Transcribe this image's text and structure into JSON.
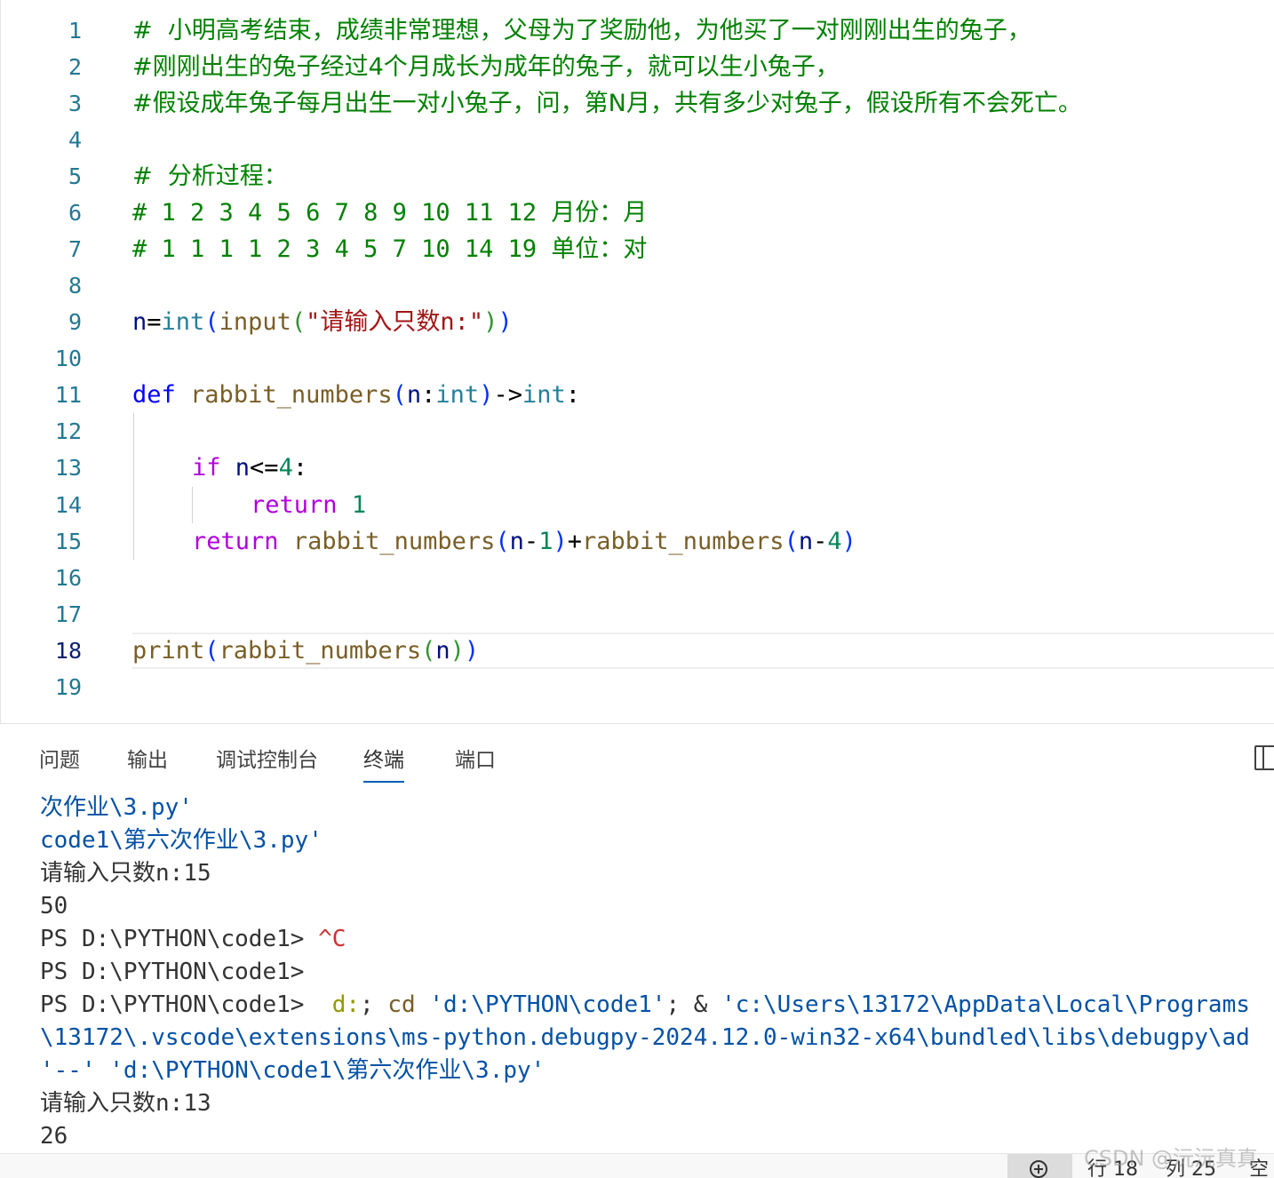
{
  "editor": {
    "active_line": "18",
    "lines": [
      {
        "num": "1",
        "comment": "#  小明高考结束，成绩非常理想，父母为了奖励他，为他买了一对刚刚出生的兔子，"
      },
      {
        "num": "2",
        "comment": "#刚刚出生的兔子经过4个月成长为成年的兔子，就可以生小兔子，"
      },
      {
        "num": "3",
        "comment": "#假设成年兔子每月出生一对小兔子，问，第N月，共有多少对兔子，假设所有不会死亡。"
      },
      {
        "num": "4"
      },
      {
        "num": "5",
        "comment": "#  分析过程："
      },
      {
        "num": "6",
        "comment": "# 1 2 3 4 5 6 7 8 9 10 11 12 月份：月"
      },
      {
        "num": "7",
        "comment": "# 1 1 1 1 2 3 4 5 7 10 14 19 单位：对"
      },
      {
        "num": "8"
      },
      {
        "num": "9",
        "t": {
          "n": "n",
          "eq": "=",
          "int": "int",
          "p1": "(",
          "input": "input",
          "p2": "(",
          "s1": "\"",
          "s2": "请输入只数",
          "s3": "n:\"",
          "p3": ")",
          "p4": ")"
        }
      },
      {
        "num": "10"
      },
      {
        "num": "11",
        "t": {
          "def": "def",
          "sp": " ",
          "fname": "rabbit_numbers",
          "p1": "(",
          "n": "n",
          "colon": ":",
          "int": "int",
          "p2": ")",
          "arrow": "->",
          "ret": "int",
          "end": ":"
        }
      },
      {
        "num": "12"
      },
      {
        "num": "13",
        "t": {
          "kw": "if",
          "sp": " ",
          "n": "n",
          "op": "<=",
          "four": "4",
          "end": ":"
        }
      },
      {
        "num": "14",
        "t": {
          "kw": "return",
          "sp": " ",
          "one": "1"
        }
      },
      {
        "num": "15",
        "t": {
          "kw": "return",
          "sp": " ",
          "f1": "rabbit_numbers",
          "p1": "(",
          "n1": "n",
          "m1": "-",
          "one": "1",
          "p2": ")",
          "plus": "+",
          "f2": "rabbit_numbers",
          "p3": "(",
          "n2": "n",
          "m2": "-",
          "four": "4",
          "p4": ")"
        }
      },
      {
        "num": "16"
      },
      {
        "num": "17"
      },
      {
        "num": "18",
        "t": {
          "print": "print",
          "p1": "(",
          "f": "rabbit_numbers",
          "p2": "(",
          "n": "n",
          "p3": ")",
          "p4": ")"
        }
      },
      {
        "num": "19"
      }
    ]
  },
  "panel": {
    "tabs": [
      "问题",
      "输出",
      "调试控制台",
      "终端",
      "端口"
    ],
    "active_tab": "终端"
  },
  "terminal": {
    "l1": {
      "a": "次作业",
      "b": "\\3.py'"
    },
    "l2": {
      "a": "code1\\",
      "b": "第六次作业",
      "c": "\\3.py'"
    },
    "l3": {
      "a": "请输入只数",
      "b": "n:15"
    },
    "l4": "50",
    "l5": {
      "prompt": "PS D:\\PYTHON\\code1> ",
      "ctrl": "^C"
    },
    "l6": {
      "prompt": "PS D:\\PYTHON\\code1>"
    },
    "l7": {
      "prompt": "PS D:\\PYTHON\\code1> ",
      "d": " d:",
      "semi1": "; ",
      "cd": "cd",
      "sp": " ",
      "path": "'d:\\PYTHON\\code1'",
      "semi2": "; ",
      "amp": "& ",
      "exe": "'c:\\Users\\13172\\AppData\\Local\\Programs"
    },
    "l8": "\\13172\\.vscode\\extensions\\ms-python.debugpy-2024.12.0-win32-x64\\bundled\\libs\\debugpy\\ad",
    "l9": {
      "a": "'--'",
      "sp": " ",
      "b": "'d:\\PYTHON\\code1\\",
      "c": "第六次作业",
      "d": "\\3.py'"
    },
    "l10": {
      "a": "请输入只数",
      "b": "n:13"
    },
    "l11": "26"
  },
  "statusbar": {
    "row": "行 18",
    "col": "列 25",
    "extra": "空"
  },
  "watermark": "CSDN @沅沅真真"
}
